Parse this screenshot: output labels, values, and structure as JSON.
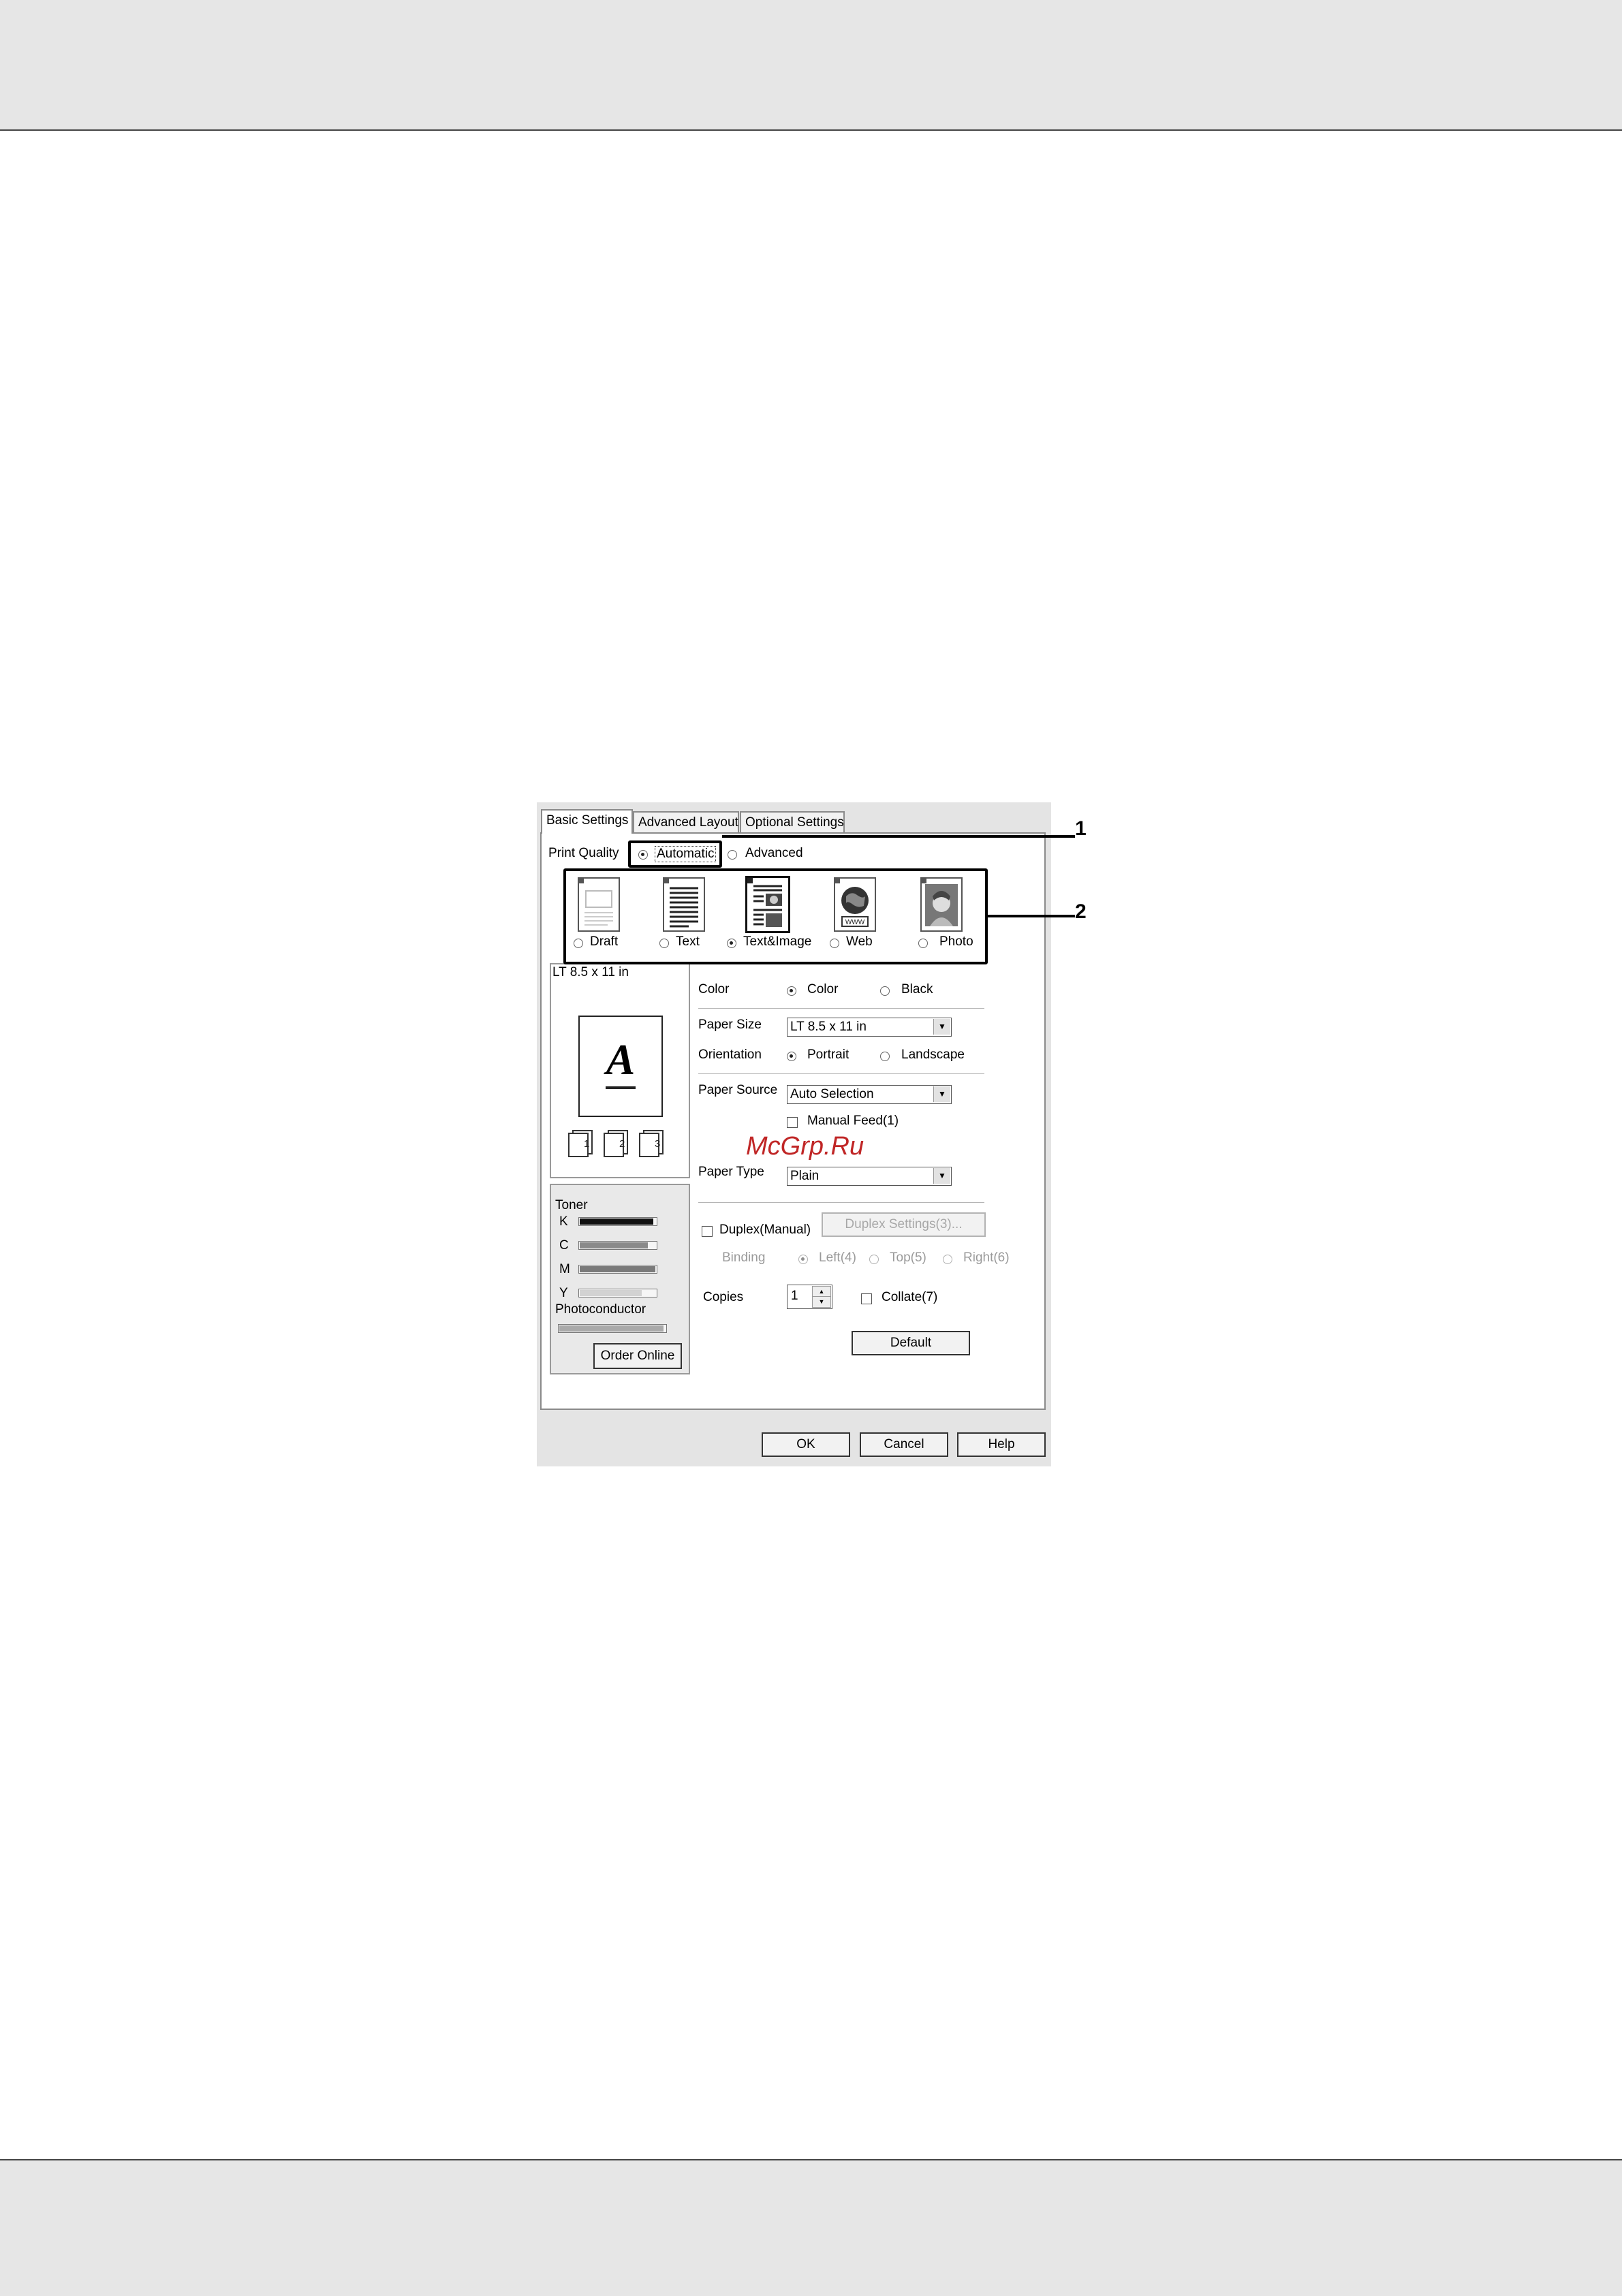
{
  "tabs": [
    "Basic Settings",
    "Advanced Layout",
    "Optional Settings"
  ],
  "print_quality": {
    "label": "Print Quality",
    "automatic": "Automatic",
    "advanced": "Advanced",
    "modes": [
      {
        "label": "Draft",
        "icon": "draft-page-icon",
        "selected": false
      },
      {
        "label": "Text",
        "icon": "text-page-icon",
        "selected": false
      },
      {
        "label": "Text&Image",
        "icon": "text-image-page-icon",
        "selected": true
      },
      {
        "label": "Web",
        "icon": "web-globe-icon",
        "selected": false
      },
      {
        "label": "Photo",
        "icon": "photo-page-icon",
        "selected": false
      }
    ]
  },
  "preview": {
    "paper_label": "LT 8.5 x 11 in",
    "letter": "A",
    "collate_numbers": [
      "1",
      "2",
      "3"
    ]
  },
  "color": {
    "label": "Color",
    "option_color": "Color",
    "option_black": "Black",
    "selected": "Color"
  },
  "paper_size": {
    "label": "Paper Size",
    "value": "LT 8.5 x 11 in"
  },
  "orientation": {
    "label": "Orientation",
    "portrait": "Portrait",
    "landscape": "Landscape",
    "selected": "Portrait"
  },
  "paper_source": {
    "label": "Paper Source",
    "value": "Auto Selection",
    "manual_feed": "Manual Feed(1)"
  },
  "paper_type": {
    "label": "Paper Type",
    "value": "Plain"
  },
  "watermark": "McGrp.Ru",
  "duplex": {
    "label": "Duplex(Manual)",
    "settings_button": "Duplex Settings(3)...",
    "binding_label": "Binding",
    "left": "Left(4)",
    "top": "Top(5)",
    "right": "Right(6)"
  },
  "copies": {
    "label": "Copies",
    "value": "1",
    "collate": "Collate(7)"
  },
  "toner": {
    "label": "Toner",
    "levels": [
      {
        "name": "K",
        "level": 0.95,
        "color": "#111111"
      },
      {
        "name": "C",
        "level": 0.88,
        "color": "#8a8a8a"
      },
      {
        "name": "M",
        "level": 0.97,
        "color": "#7a7a7a"
      },
      {
        "name": "Y",
        "level": 0.8,
        "color": "#d2d2d2"
      }
    ],
    "photoconductor_label": "Photoconductor",
    "photoconductor_level": 0.97,
    "order_online": "Order Online"
  },
  "buttons": {
    "default": "Default",
    "ok": "OK",
    "cancel": "Cancel",
    "help": "Help"
  },
  "callouts": [
    "1",
    "2"
  ]
}
